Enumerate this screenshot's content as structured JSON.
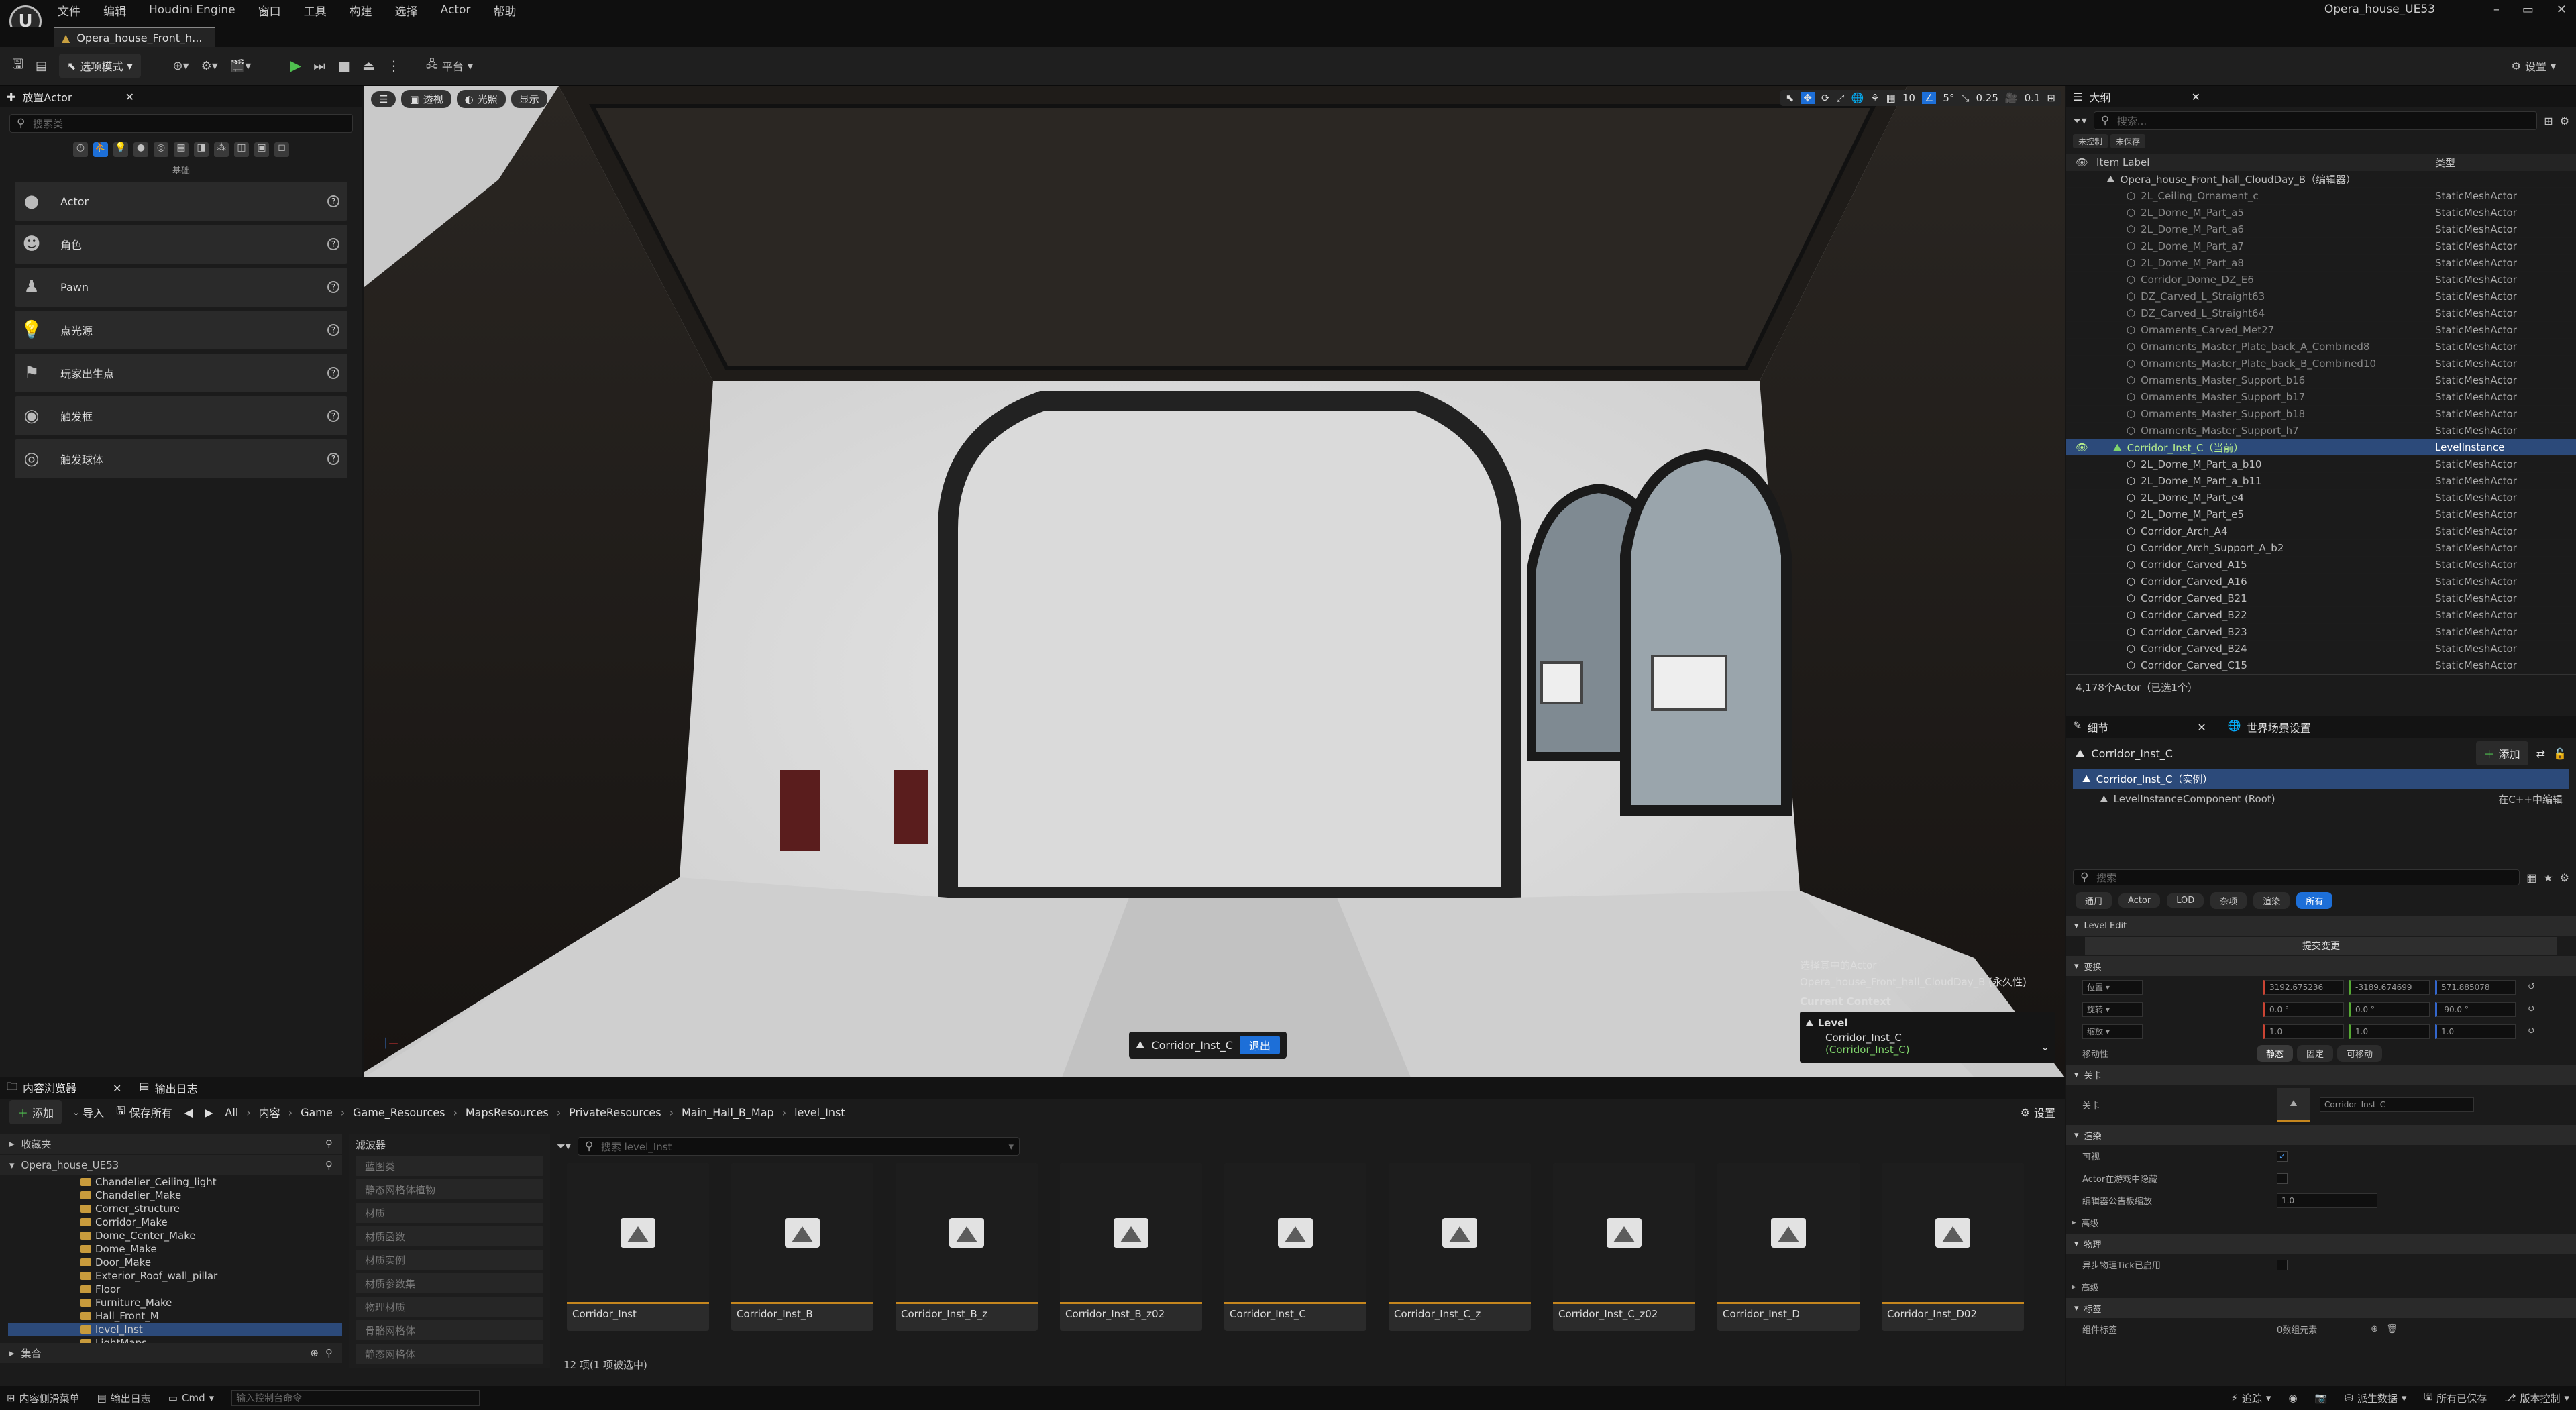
{
  "app": {
    "logo": "U",
    "window_title": "Opera_house_UE53",
    "doc_tab": "Opera_house_Front_h...",
    "win_controls": [
      "–",
      "▭",
      "✕"
    ]
  },
  "menu": [
    "文件",
    "编辑",
    "Houdini Engine",
    "窗口",
    "工具",
    "构建",
    "选择",
    "Actor",
    "帮助"
  ],
  "toolbar": {
    "mode": "选项模式",
    "platform": "平台",
    "settings": "设置"
  },
  "place_actors": {
    "title": "放置Actor",
    "search_placeholder": "搜索类",
    "basic_label": "基础",
    "items": [
      {
        "label": "Actor",
        "icon": "sphere-icon"
      },
      {
        "label": "角色",
        "icon": "character-icon"
      },
      {
        "label": "Pawn",
        "icon": "pawn-icon"
      },
      {
        "label": "点光源",
        "icon": "point-light-icon"
      },
      {
        "label": "玩家出生点",
        "icon": "player-start-icon"
      },
      {
        "label": "触发框",
        "icon": "trigger-box-icon"
      },
      {
        "label": "触发球体",
        "icon": "trigger-sphere-icon"
      }
    ]
  },
  "viewport": {
    "perspective": "透视",
    "lit": "光照",
    "show": "显示",
    "snap_grid": "10",
    "snap_angle": "5°",
    "snap_scale": "0.25",
    "camera_speed": "0.1",
    "level_instance": "Corridor_Inst_C",
    "exit_label": "退出",
    "selected_actor_label": "选择其中的Actor",
    "selected_actor": "Opera_house_Front_hall_CloudDay_B (永久性)",
    "current_context": "Current Context",
    "context_level": "Level",
    "context_instance": "Corridor_Inst_C",
    "context_instance_sub": "(Corridor_Inst_C)"
  },
  "outliner": {
    "title": "大纲",
    "search_placeholder": "搜索...",
    "tags": [
      "未控制",
      "未保存"
    ],
    "col_label": "Item Label",
    "col_type": "类型",
    "root": "Opera_house_Front_hall_CloudDay_B（编辑器）",
    "rows": [
      {
        "name": "2L_Ceiling_Ornament_c",
        "type": "StaticMeshActor",
        "dim": true
      },
      {
        "name": "2L_Dome_M_Part_a5",
        "type": "StaticMeshActor",
        "dim": true
      },
      {
        "name": "2L_Dome_M_Part_a6",
        "type": "StaticMeshActor",
        "dim": true
      },
      {
        "name": "2L_Dome_M_Part_a7",
        "type": "StaticMeshActor",
        "dim": true
      },
      {
        "name": "2L_Dome_M_Part_a8",
        "type": "StaticMeshActor",
        "dim": true
      },
      {
        "name": "Corridor_Dome_DZ_E6",
        "type": "StaticMeshActor",
        "dim": true
      },
      {
        "name": "DZ_Carved_L_Straight63",
        "type": "StaticMeshActor",
        "dim": true
      },
      {
        "name": "DZ_Carved_L_Straight64",
        "type": "StaticMeshActor",
        "dim": true
      },
      {
        "name": "Ornaments_Carved_Met27",
        "type": "StaticMeshActor",
        "dim": true
      },
      {
        "name": "Ornaments_Master_Plate_back_A_Combined8",
        "type": "StaticMeshActor",
        "dim": true
      },
      {
        "name": "Ornaments_Master_Plate_back_B_Combined10",
        "type": "StaticMeshActor",
        "dim": true
      },
      {
        "name": "Ornaments_Master_Support_b16",
        "type": "StaticMeshActor",
        "dim": true
      },
      {
        "name": "Ornaments_Master_Support_b17",
        "type": "StaticMeshActor",
        "dim": true
      },
      {
        "name": "Ornaments_Master_Support_b18",
        "type": "StaticMeshActor",
        "dim": true
      },
      {
        "name": "Ornaments_Master_Support_h7",
        "type": "StaticMeshActor",
        "dim": true
      },
      {
        "name": "Corridor_Inst_C（当前）",
        "type": "LevelInstance",
        "sel": true
      },
      {
        "name": "2L_Dome_M_Part_a_b10",
        "type": "StaticMeshActor"
      },
      {
        "name": "2L_Dome_M_Part_a_b11",
        "type": "StaticMeshActor"
      },
      {
        "name": "2L_Dome_M_Part_e4",
        "type": "StaticMeshActor"
      },
      {
        "name": "2L_Dome_M_Part_e5",
        "type": "StaticMeshActor"
      },
      {
        "name": "Corridor_Arch_A4",
        "type": "StaticMeshActor"
      },
      {
        "name": "Corridor_Arch_Support_A_b2",
        "type": "StaticMeshActor"
      },
      {
        "name": "Corridor_Carved_A15",
        "type": "StaticMeshActor"
      },
      {
        "name": "Corridor_Carved_A16",
        "type": "StaticMeshActor"
      },
      {
        "name": "Corridor_Carved_B21",
        "type": "StaticMeshActor"
      },
      {
        "name": "Corridor_Carved_B22",
        "type": "StaticMeshActor"
      },
      {
        "name": "Corridor_Carved_B23",
        "type": "StaticMeshActor"
      },
      {
        "name": "Corridor_Carved_B24",
        "type": "StaticMeshActor"
      },
      {
        "name": "Corridor_Carved_C15",
        "type": "StaticMeshActor"
      }
    ],
    "count": "4,178个Actor（已选1个）"
  },
  "details": {
    "tab": "细节",
    "tab2": "世界场景设置",
    "actor": "Corridor_Inst_C",
    "add": "添加",
    "instance": "Corridor_Inst_C（实例）",
    "component": "LevelInstanceComponent (Root)",
    "edit_cpp": "在C++中编辑",
    "search_placeholder": "搜索",
    "filters": [
      "通用",
      "Actor",
      "LOD",
      "杂项",
      "渲染",
      "所有"
    ],
    "level_edit": "Level Edit",
    "commit": "提交变更",
    "transform": "变换",
    "location_label": "位置",
    "rotation_label": "旋转",
    "scale_label": "缩放",
    "mobility_label": "移动性",
    "location": [
      "3192.675236",
      "-3189.674699",
      "571.885078"
    ],
    "rotation": [
      "0.0 °",
      "0.0 °",
      "-90.0 °"
    ],
    "scale": [
      "1.0",
      "1.0",
      "1.0"
    ],
    "mobility": [
      "静态",
      "固定",
      "可移动"
    ],
    "level_section": "关卡",
    "level_row": "关卡",
    "level_value": "Corridor_Inst_C",
    "render_section": "渲染",
    "visible": "可视",
    "hidden_in_game": "Actor在游戏中隐藏",
    "editor_billboard": "编辑器公告板缩放",
    "billboard_value": "1.0",
    "advanced": "高级",
    "physics": "物理",
    "async_physics": "异步物理Tick已启用",
    "advanced2": "高级",
    "tags": "标签",
    "component_tags": "组件标签",
    "tags_value": "0数组元素"
  },
  "content_browser": {
    "tab": "内容浏览器",
    "tab2": "输出日志",
    "add": "添加",
    "import": "导入",
    "save_all": "保存所有",
    "settings": "设置",
    "path": [
      "All",
      "内容",
      "Game",
      "Game_Resources",
      "MapsResources",
      "PrivateResources",
      "Main_Hall_B_Map",
      "level_Inst"
    ],
    "favorites": "收藏夹",
    "project": "Opera_house_UE53",
    "collections": "集合",
    "folders": [
      "Chandelier_Ceiling_light",
      "Chandelier_Make",
      "Corner_structure",
      "Corridor_Make",
      "Dome_Center_Make",
      "Dome_Make",
      "Door_Make",
      "Exterior_Roof_wall_pillar",
      "Floor",
      "Furniture_Make",
      "Hall_Front_M",
      "level_Inst",
      "LightMaps"
    ],
    "filters_label": "滤波器",
    "filters": [
      "蓝图类",
      "静态网格体植物",
      "材质",
      "材质函数",
      "材质实例",
      "材质参数集",
      "物理材质",
      "骨骼网格体",
      "静态网格体"
    ],
    "search_placeholder": "搜索 level_Inst",
    "assets": [
      "Corridor_Inst",
      "Corridor_Inst_B",
      "Corridor_Inst_B_z",
      "Corridor_Inst_B_z02",
      "Corridor_Inst_C",
      "Corridor_Inst_C_z",
      "Corridor_Inst_C_z02",
      "Corridor_Inst_D",
      "Corridor_Inst_D02"
    ],
    "count": "12 项(1 项被选中)"
  },
  "statusbar": {
    "drawer": "内容侧滑菜单",
    "log": "输出日志",
    "cmd": "Cmd",
    "cmd_placeholder": "输入控制台命令",
    "trace": "追踪",
    "derived": "派生数据",
    "saved": "所有已保存",
    "source": "版本控制"
  }
}
